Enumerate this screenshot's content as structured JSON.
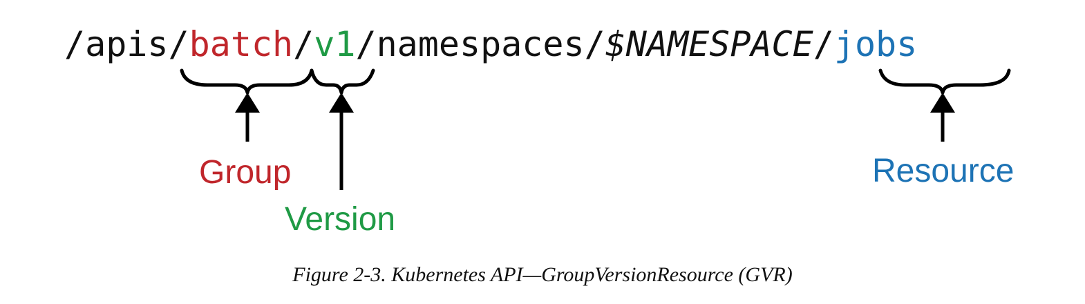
{
  "diagram": {
    "path": {
      "prefix": "/apis/",
      "group": "batch",
      "sep1": "/",
      "version": "v1",
      "middle": "/namespaces/",
      "namespace": "$NAMESPACE",
      "sep2": "/",
      "resource": "jobs"
    },
    "labels": {
      "group": "Group",
      "version": "Version",
      "resource": "Resource"
    },
    "colors": {
      "group": "#c0262b",
      "version": "#1f9a45",
      "resource": "#1d73b5",
      "text": "#111111"
    }
  },
  "caption": "Figure 2-3. Kubernetes API—GroupVersionResource (GVR)"
}
